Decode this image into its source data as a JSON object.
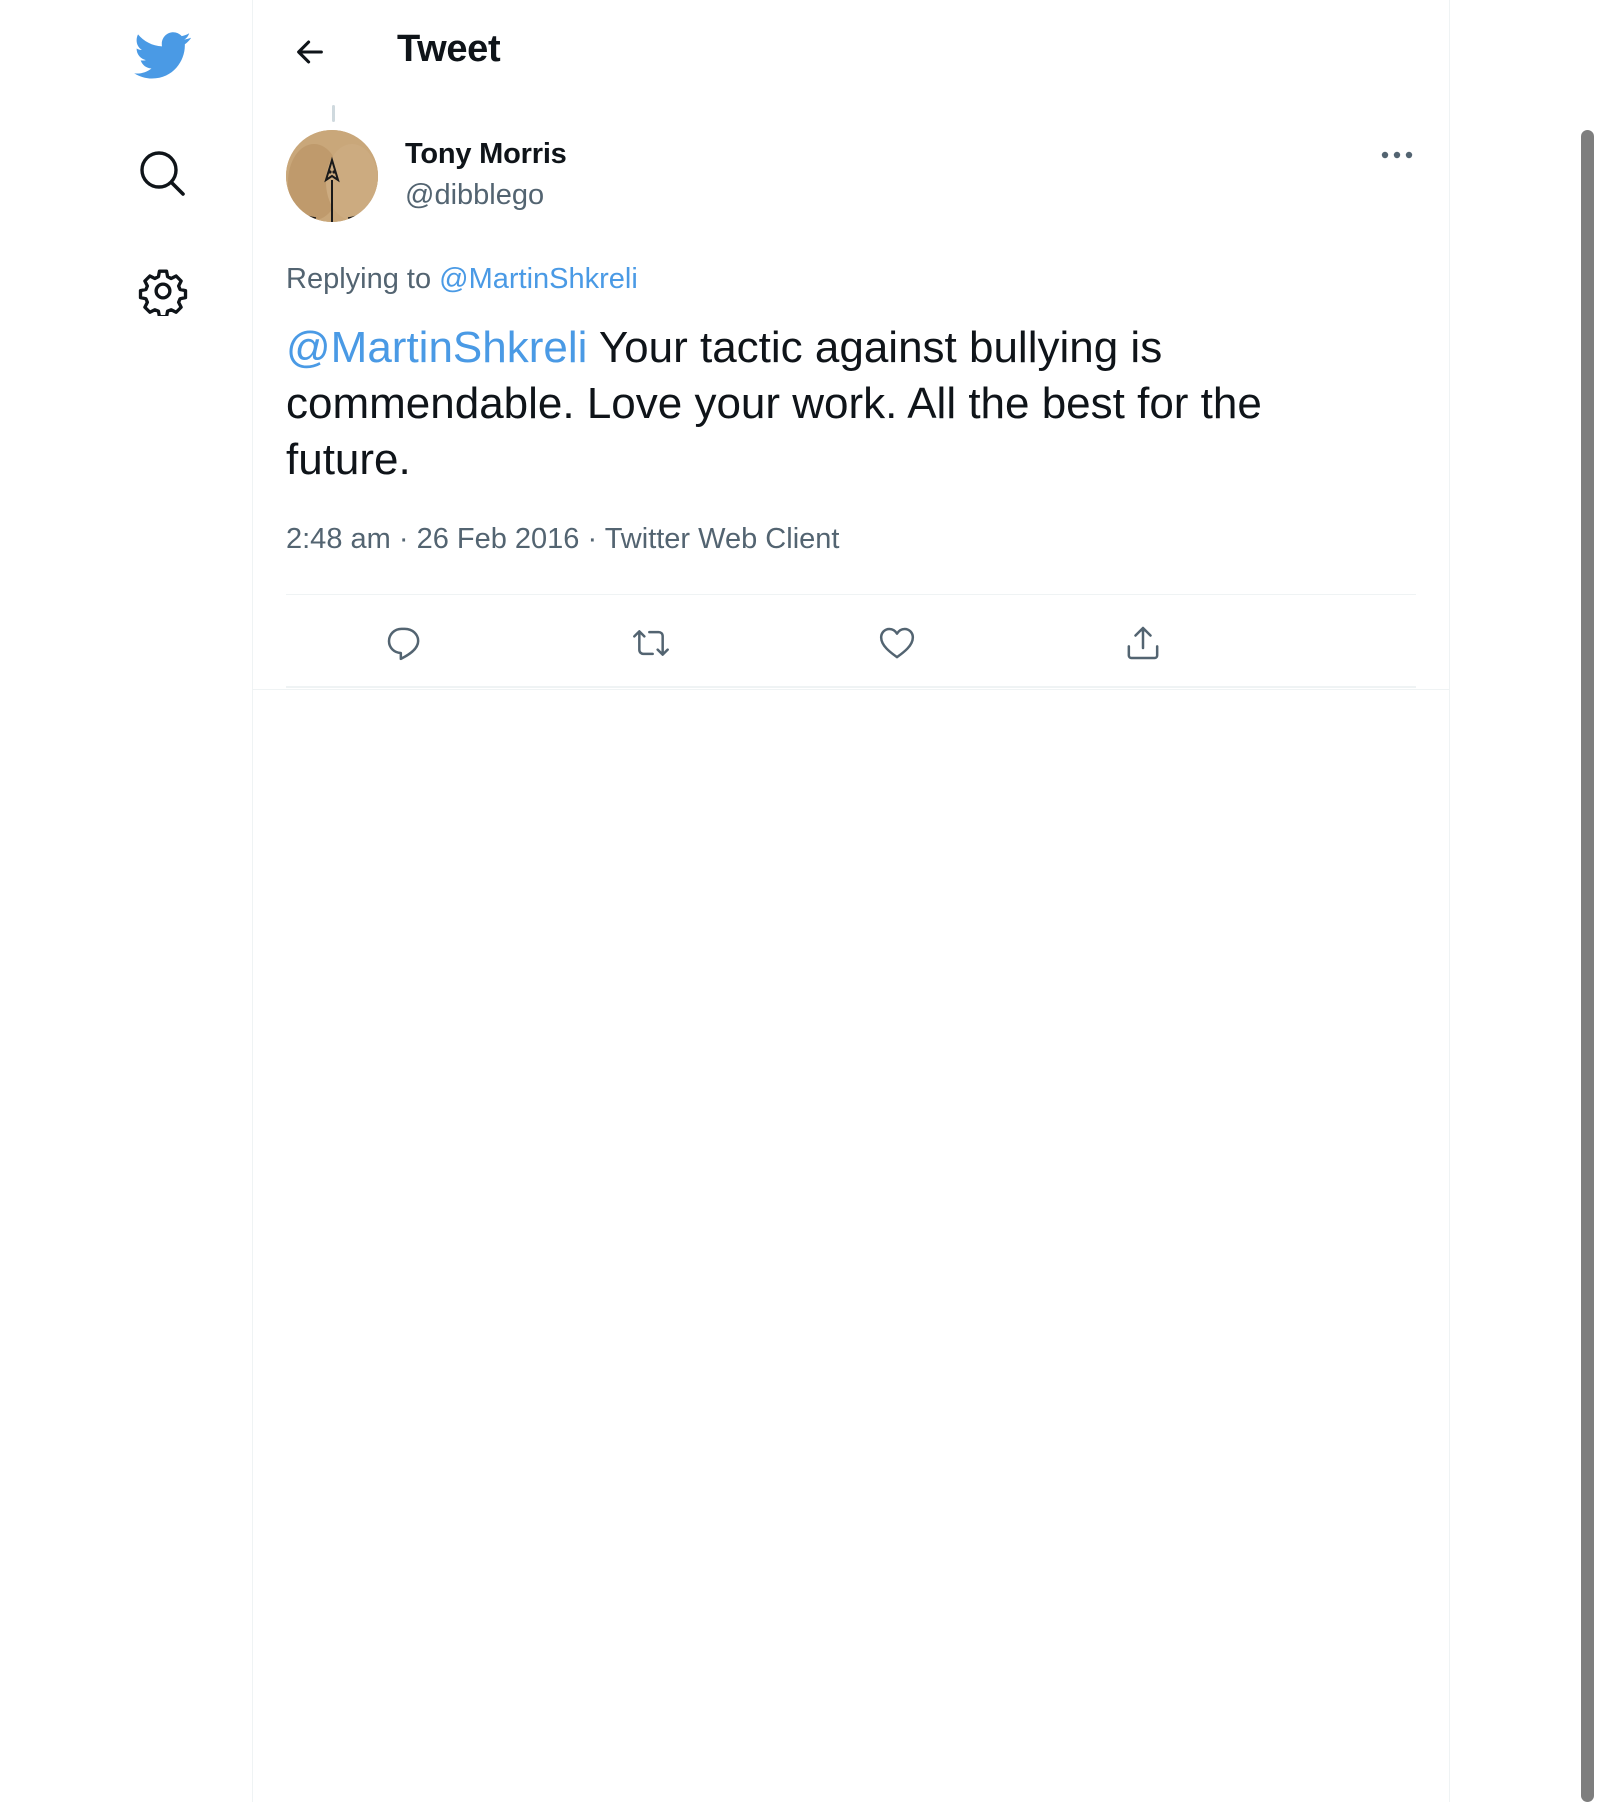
{
  "brand": {
    "color": "#4a9ae5"
  },
  "nav": {
    "icons": [
      "twitter-bird-icon",
      "search-icon",
      "gear-icon"
    ]
  },
  "header": {
    "title": "Tweet"
  },
  "tweet": {
    "author": {
      "name": "Tony Morris",
      "handle": "@dibblego"
    },
    "replying_prefix": "Replying to",
    "replying_to": "@MartinShkreli",
    "mention": "@MartinShkreli",
    "body": " Your tactic against bullying is commendable. Love your work. All the best for the future.",
    "time": "2:48 am",
    "separator": " · ",
    "date": "26 Feb 2016",
    "source": "Twitter Web Client"
  },
  "actions": [
    "reply-icon",
    "retweet-icon",
    "like-icon",
    "share-icon"
  ]
}
